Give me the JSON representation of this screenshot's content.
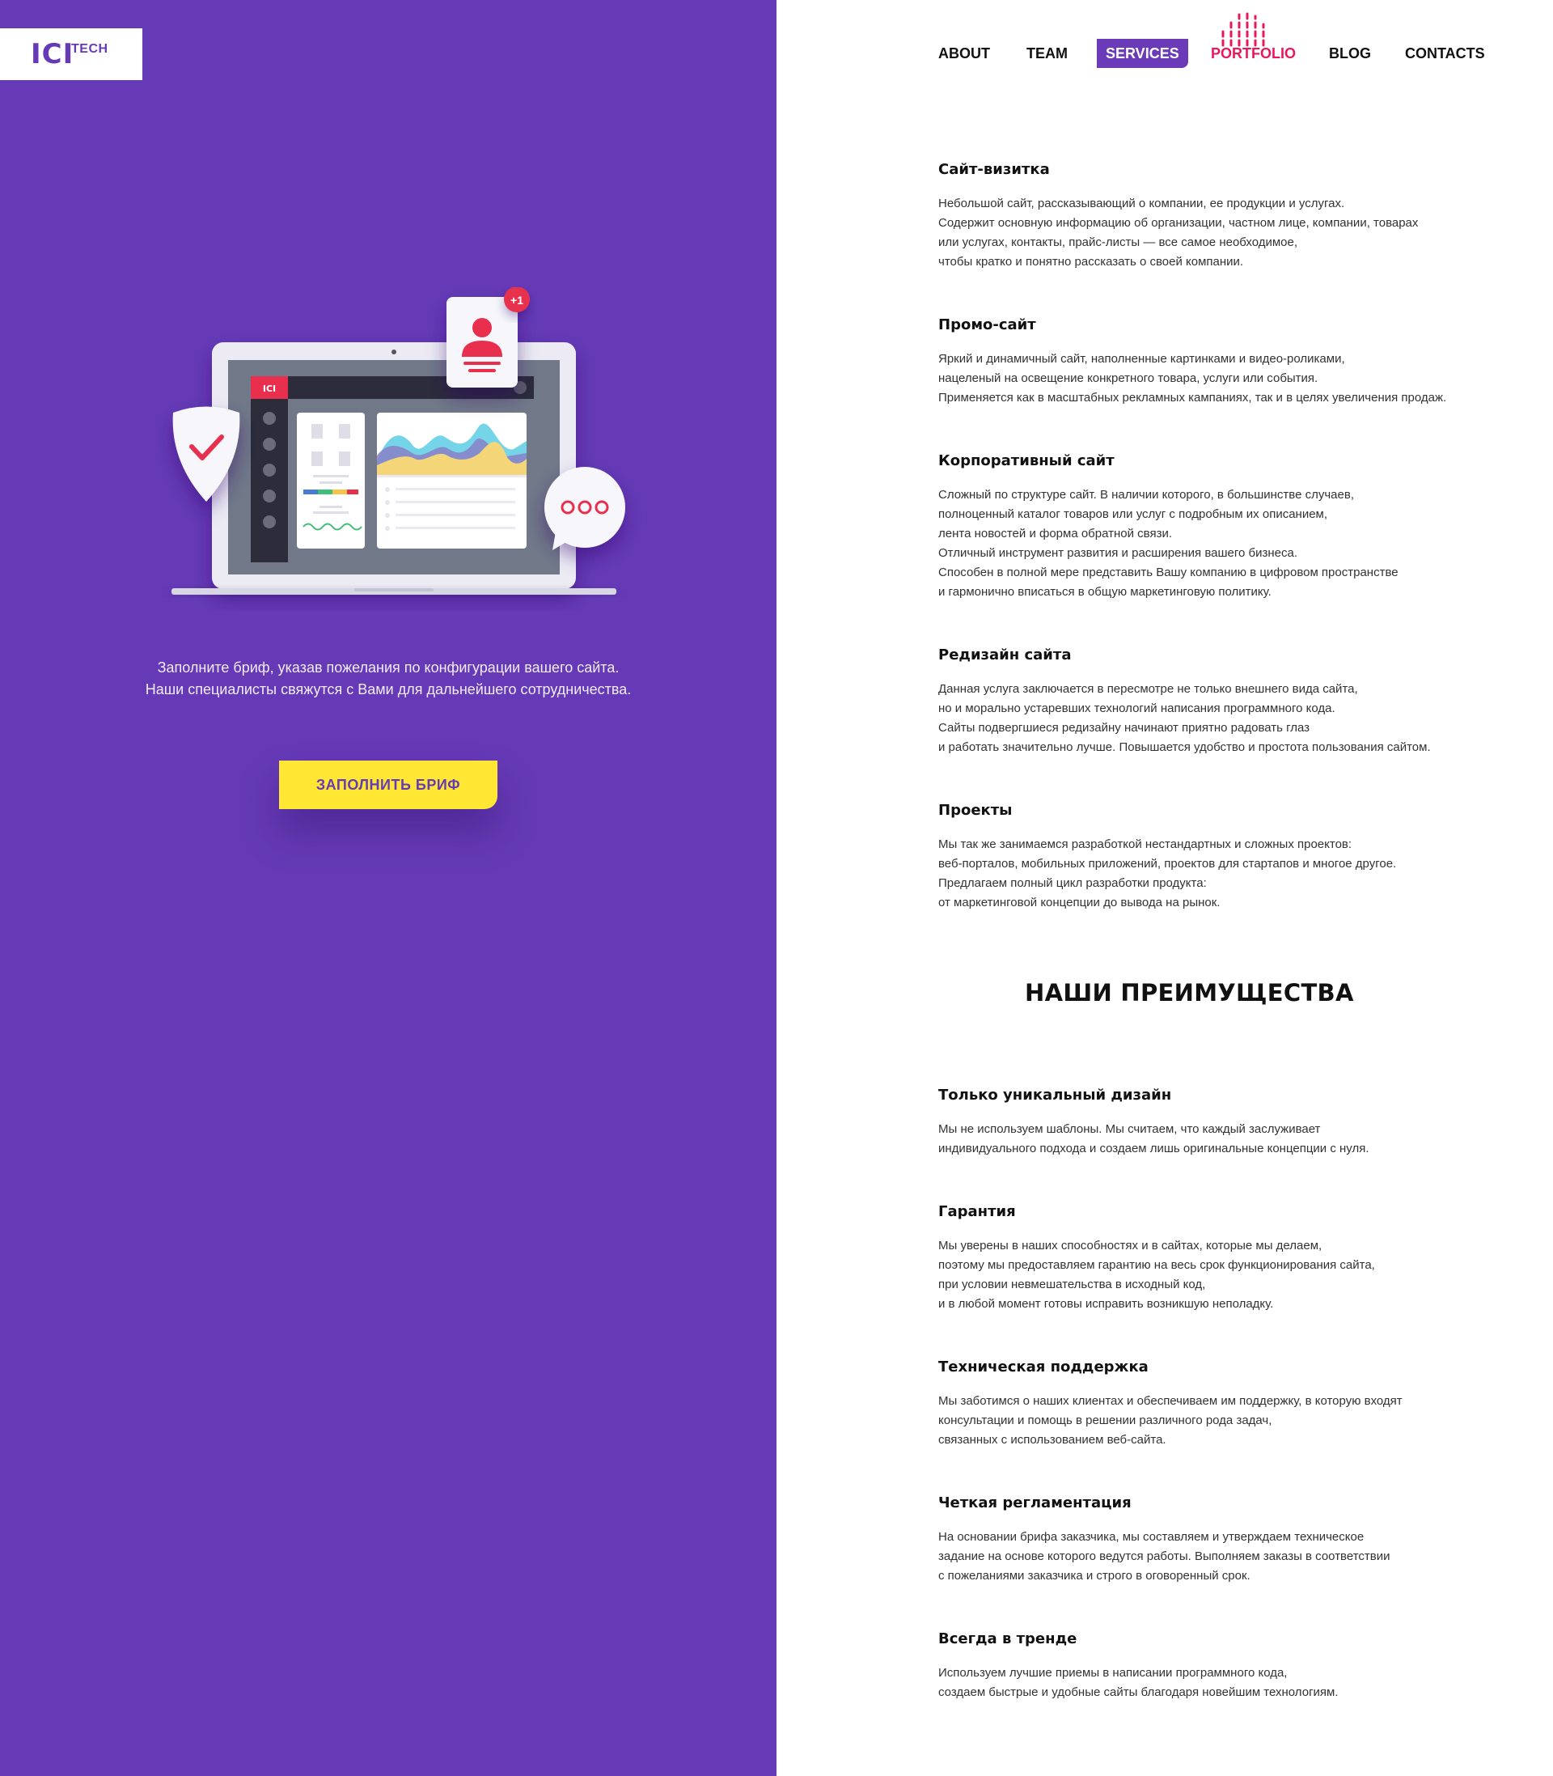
{
  "logo": {
    "main": "ICI",
    "sub": "TECH"
  },
  "nav": {
    "items": [
      {
        "label": "ABOUT"
      },
      {
        "label": "TEAM"
      },
      {
        "label": "SERVICES"
      },
      {
        "label": "PORTFOLIO"
      },
      {
        "label": "BLOG"
      },
      {
        "label": "CONTACTS"
      }
    ]
  },
  "hero": {
    "screen_logo": "ICI",
    "badge": "+1",
    "brief_lines": [
      "Заполните бриф, указав пожелания по конфигурации вашего сайта.",
      "Наши специалисты свяжутся с Вами для дальнейшего сотрудничества."
    ],
    "cta_label": "ЗАПОЛНИТЬ БРИФ"
  },
  "services": [
    {
      "title": "Сайт-визитка",
      "text": "Небольшой сайт, рассказывающий о компании, ее продукции и услугах.\nСодержит основную информацию об организации, частном лице, компании, товарах\nили услугах, контакты, прайс-листы — все самое необходимое,\nчтобы кратко и понятно рассказать о своей компании."
    },
    {
      "title": "Промо-сайт",
      "text": "Яркий и динамичный сайт, наполненные картинками и видео-роликами,\nнацеленый на освещение конкретного товара, услуги или события.\nПрименяется как в масштабных рекламных кампаниях, так и в целях увеличения продаж."
    },
    {
      "title": "Корпоративный сайт",
      "text": "Сложный по структуре сайт. В наличии которого, в большинстве случаев,\nполноценный каталог товаров или услуг с подробным их описанием,\nлента новостей и форма обратной связи.\nОтличный инструмент развития и расширения вашего бизнеса.\nСпособен в полной мере представить Вашу компанию в цифровом пространстве\nи гармонично вписаться в общую маркетинговую политику."
    },
    {
      "title": "Редизайн сайта",
      "text": "Данная услуга заключается в пересмотре не только внешнего вида сайта,\nно и морально устаревших технологий написания программного кода.\nСайты подвергшиеся редизайну начинают приятно радовать глаз\nи работать значительно лучше. Повышается удобство и простота пользования сайтом."
    },
    {
      "title": "Проекты",
      "text": "Мы так же занимаемся разработкой нестандартных и сложных проектов:\nвеб-порталов, мобильных приложений, проектов для стартапов и многое другое.\nПредлагаем полный цикл разработки продукта:\nот маркетинговой концепции до вывода на рынок."
    }
  ],
  "advantages_heading": "НАШИ ПРЕИМУЩЕСТВА",
  "advantages": [
    {
      "title": "Только уникальный дизайн",
      "text": "Мы не используем шаблоны. Мы считаем, что каждый заслуживает\nиндивидуального подхода и создаем лишь оригинальные концепции с нуля."
    },
    {
      "title": "Гарантия",
      "text": "Мы уверены в наших способностях и в сайтах, которые мы делаем,\nпоэтому мы предоставляем гарантию на весь срок функционирования сайта,\nпри условии невмешательства в исходный код,\nи в любой момент готовы исправить возникшую неполадку."
    },
    {
      "title": "Техническая поддержка",
      "text": "Мы заботимся о наших клиентах и обеспечиваем им поддержку, в которую входят\nконсультации и помощь в решении различного рода задач,\nсвязанных с использованием веб-сайта."
    },
    {
      "title": "Четкая регламентация",
      "text": "На основании брифа заказчика, мы составляем и утверждаем техническое\nзадание на основе которого ведутся работы. Выполняем заказы в соответствии\nс пожеланиями заказчика и строго в оговоренный срок."
    },
    {
      "title": "Всегда в тренде",
      "text": "Используем лучшие приемы в написании программного кода,\nсоздаем быстрые и удобные сайты благодаря новейшим технологиям."
    }
  ],
  "colors": {
    "brand_purple": "#663ab6",
    "cta_yellow": "#ffe734",
    "accent_red": "#e8185b"
  }
}
